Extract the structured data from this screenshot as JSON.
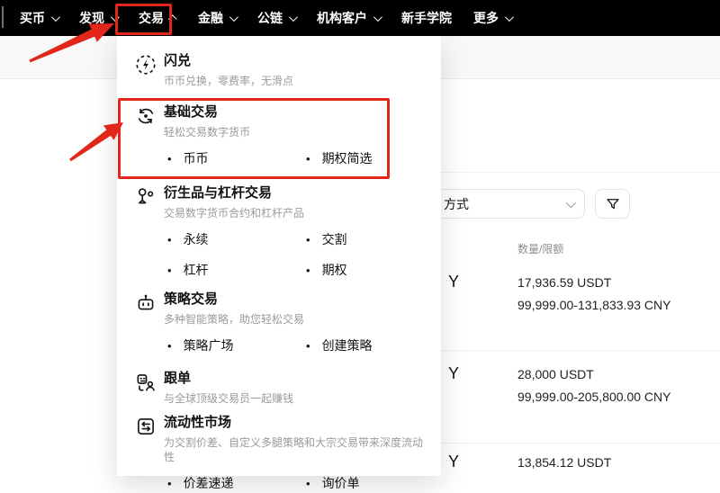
{
  "colors": {
    "annotation_red": "#e3261a",
    "nav_bg": "#000000",
    "accent_text": "#121212"
  },
  "nav": {
    "items": [
      {
        "label": "买币",
        "caret": "down"
      },
      {
        "label": "发现",
        "caret": "down"
      },
      {
        "label": "交易",
        "caret": "up",
        "highlighted": true
      },
      {
        "label": "金融",
        "caret": "down"
      },
      {
        "label": "公链",
        "caret": "down"
      },
      {
        "label": "机构客户",
        "caret": "down"
      },
      {
        "label": "新手学院",
        "caret": "none"
      },
      {
        "label": "更多",
        "caret": "down"
      }
    ]
  },
  "menu": {
    "sections": [
      {
        "icon": "flash-exchange-icon",
        "title": "闪兑",
        "subtitle": "币币兑换，零费率，无滑点",
        "links": []
      },
      {
        "icon": "basic-trading-icon",
        "title": "基础交易",
        "subtitle": "轻松交易数字货币",
        "links": [
          "币币",
          "期权简选"
        ],
        "highlighted": true
      },
      {
        "icon": "derivatives-icon",
        "title": "衍生品与杠杆交易",
        "subtitle": "交易数字货币合约和杠杆产品",
        "links": [
          "永续",
          "交割",
          "杠杆",
          "期权"
        ]
      },
      {
        "icon": "strategy-icon",
        "title": "策略交易",
        "subtitle": "多种智能策略，助您轻松交易",
        "links": [
          "策略广场",
          "创建策略"
        ]
      },
      {
        "icon": "copy-trading-icon",
        "title": "跟单",
        "subtitle": "与全球顶级交易员一起赚钱",
        "links": []
      },
      {
        "icon": "liquidity-icon",
        "title": "流动性市场",
        "subtitle": "为交割价差、自定义多腿策略和大宗交易带来深度流动性",
        "links": [
          "价差速递",
          "询价单"
        ]
      }
    ]
  },
  "content": {
    "method_filter_label": "方式",
    "amount_header": "数量/限额",
    "rows": [
      {
        "currency": "Y",
        "amount": "17,936.59 USDT",
        "limit": "99,999.00-131,833.93 CNY"
      },
      {
        "currency": "Y",
        "amount": "28,000 USDT",
        "limit": "99,999.00-205,800.00 CNY"
      },
      {
        "currency": "Y",
        "amount": "13,854.12 USDT",
        "limit": ""
      }
    ]
  }
}
